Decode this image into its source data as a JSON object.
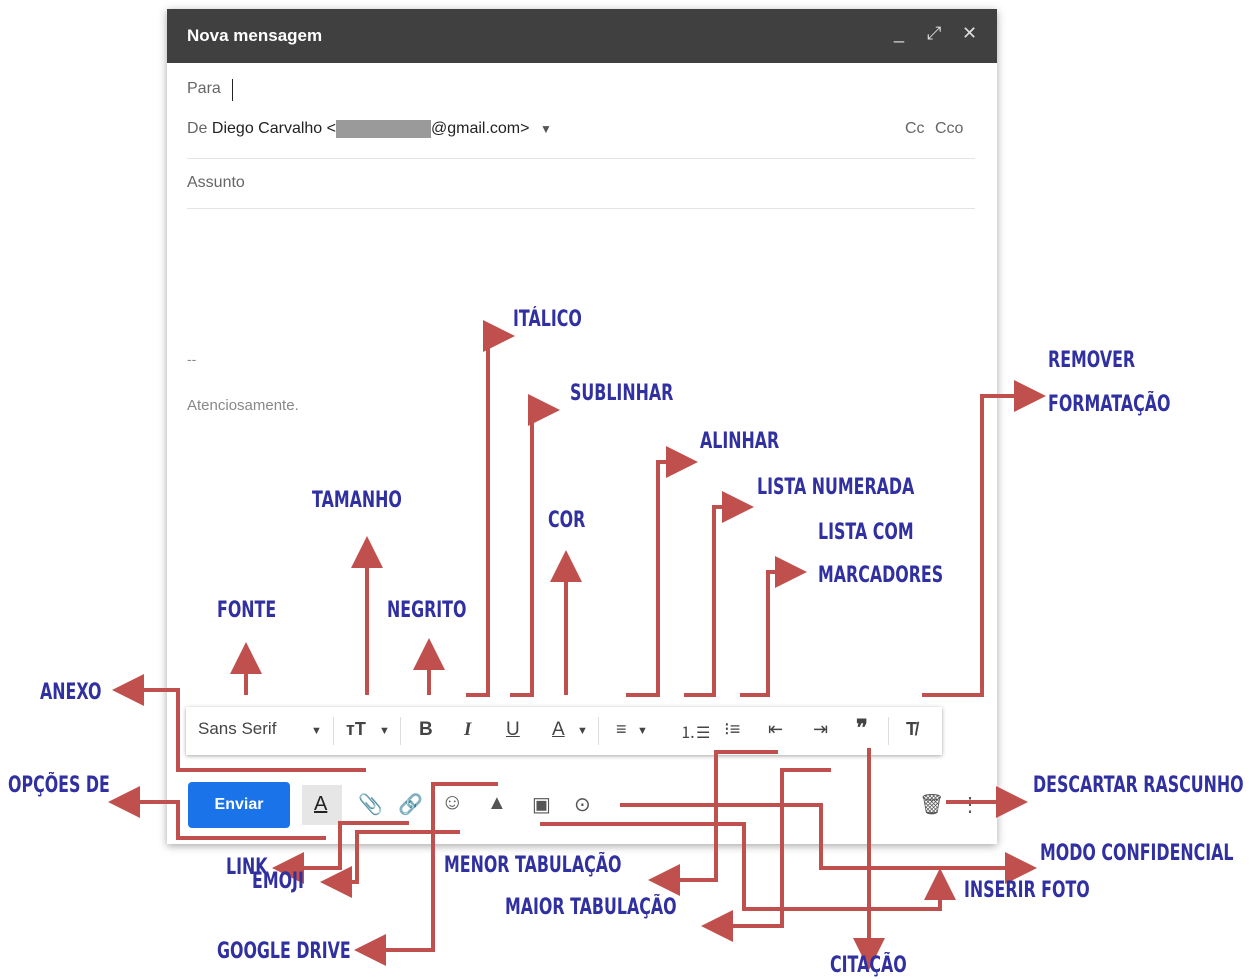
{
  "window": {
    "title": "Nova mensagem",
    "controls": {
      "minimize": "_",
      "expand": "⤢",
      "close": "✕"
    }
  },
  "to_field": {
    "label": "Para"
  },
  "from_field": {
    "label": "De",
    "name": "Diego Carvalho <",
    "email_suffix": "@gmail.com>",
    "cc": "Cc",
    "bcc": "Cco"
  },
  "subject": {
    "placeholder": "Assunto"
  },
  "body": {
    "signature_dash": "--",
    "signature_text": "Atenciosamente."
  },
  "formatting_bar": {
    "font": "Sans Serif",
    "bold": "B",
    "italic": "I",
    "underline": "U",
    "text_color": "A"
  },
  "send_button": "Enviar",
  "annotations": {
    "italico": "ITÁLICO",
    "sublinhar": "SUBLINHAR",
    "remover_1": "REMOVER",
    "remover_2": "FORMATAÇÃO",
    "alinhar": "ALINHAR",
    "lista_numerada": "LISTA NUMERADA",
    "lista_com_1": "LISTA COM",
    "lista_com_2": "MARCADORES",
    "tamanho": "TAMANHO",
    "cor": "COR",
    "fonte": "FONTE",
    "negrito": "NEGRITO",
    "anexo": "ANEXO",
    "opcoes": "OPÇÕES DE",
    "descartar": "DESCARTAR RASCUNHO",
    "modo": "MODO CONFIDENCIAL",
    "link": "LINK",
    "menor": "MENOR TABULAÇÃO",
    "inserir": "INSERIR FOTO",
    "emoji": "EMOJI",
    "maior": "MAIOR TABULAÇÃO",
    "google_drive": "GOOGLE DRIVE",
    "citacao": "CITAÇÃO"
  },
  "colors": {
    "titlebar": "#404040",
    "send": "#1a73e8",
    "annotation_text": "#3030a0",
    "arrow": "#c0504d"
  }
}
